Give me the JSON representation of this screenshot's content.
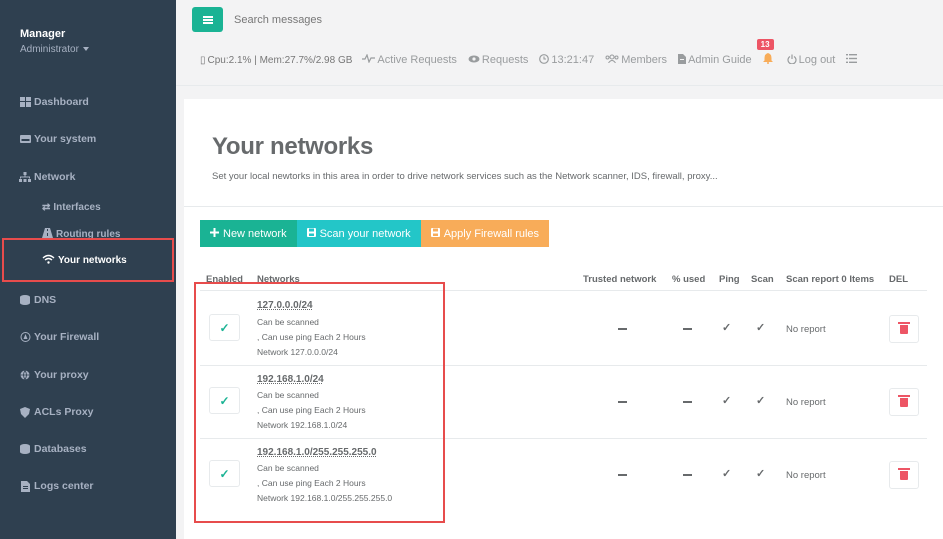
{
  "sidebar": {
    "user_name": "Manager",
    "user_role": "Administrator",
    "items": [
      {
        "label": "Dashboard",
        "icon": "dashboard-icon"
      },
      {
        "label": "Your system",
        "icon": "hdd-icon"
      },
      {
        "label": "Network",
        "icon": "sitemap-icon"
      },
      {
        "label": "DNS",
        "icon": "database-icon"
      },
      {
        "label": "Your Firewall",
        "icon": "firewall-icon"
      },
      {
        "label": "Your proxy",
        "icon": "globe-icon"
      },
      {
        "label": "ACLs Proxy",
        "icon": "shield-icon"
      },
      {
        "label": "Databases",
        "icon": "database-icon"
      },
      {
        "label": "Logs center",
        "icon": "file-icon"
      }
    ],
    "network_sub": [
      {
        "label": "Interfaces",
        "icon": "exchange-icon"
      },
      {
        "label": "Routing rules",
        "icon": "road-icon"
      },
      {
        "label": "Your networks",
        "icon": "wifi-icon"
      }
    ]
  },
  "topbar": {
    "search_placeholder": "Search messages",
    "system_stats": "Cpu:2.1% | Mem:27.7%/2.98 GB",
    "active_requests": "Active Requests",
    "requests": "Requests",
    "clock": "13:21:47",
    "members": "Members",
    "admin_guide": "Admin Guide",
    "notification_count": "13",
    "logout": "Log out"
  },
  "page": {
    "title": "Your networks",
    "description": "Set your local newtorks in this area in order to drive network services such as the Network scanner, IDS, firewall, proxy..."
  },
  "actions": {
    "new_network": "New network",
    "scan_network": "Scan your network",
    "apply_firewall": "Apply Firewall rules"
  },
  "table": {
    "headers": {
      "enabled": "Enabled",
      "networks": "Networks",
      "trusted": "Trusted network",
      "used": "% used",
      "ping": "Ping",
      "scan": "Scan",
      "report": "Scan report 0 Items",
      "del": "DEL"
    },
    "rows": [
      {
        "network": "127.0.0.0/24",
        "line1": "Can be scanned",
        "line2": ", Can use ping Each 2 Hours",
        "line3": "Network 127.0.0.0/24",
        "report": "No report"
      },
      {
        "network": "192.168.1.0/24",
        "line1": "Can be scanned",
        "line2": ", Can use ping Each 2 Hours",
        "line3": "Network 192.168.1.0/24",
        "report": "No report"
      },
      {
        "network": "192.168.1.0/255.255.255.0",
        "line1": "Can be scanned",
        "line2": ", Can use ping Each 2 Hours",
        "line3": "Network 192.168.1.0/255.255.255.0",
        "report": "No report"
      }
    ]
  },
  "colors": {
    "sidebar_bg": "#2f4050",
    "primary": "#1ab394",
    "info": "#23c6c8",
    "warning": "#f8ac59",
    "danger": "#ed5565",
    "annotation": "#e74c4c"
  }
}
